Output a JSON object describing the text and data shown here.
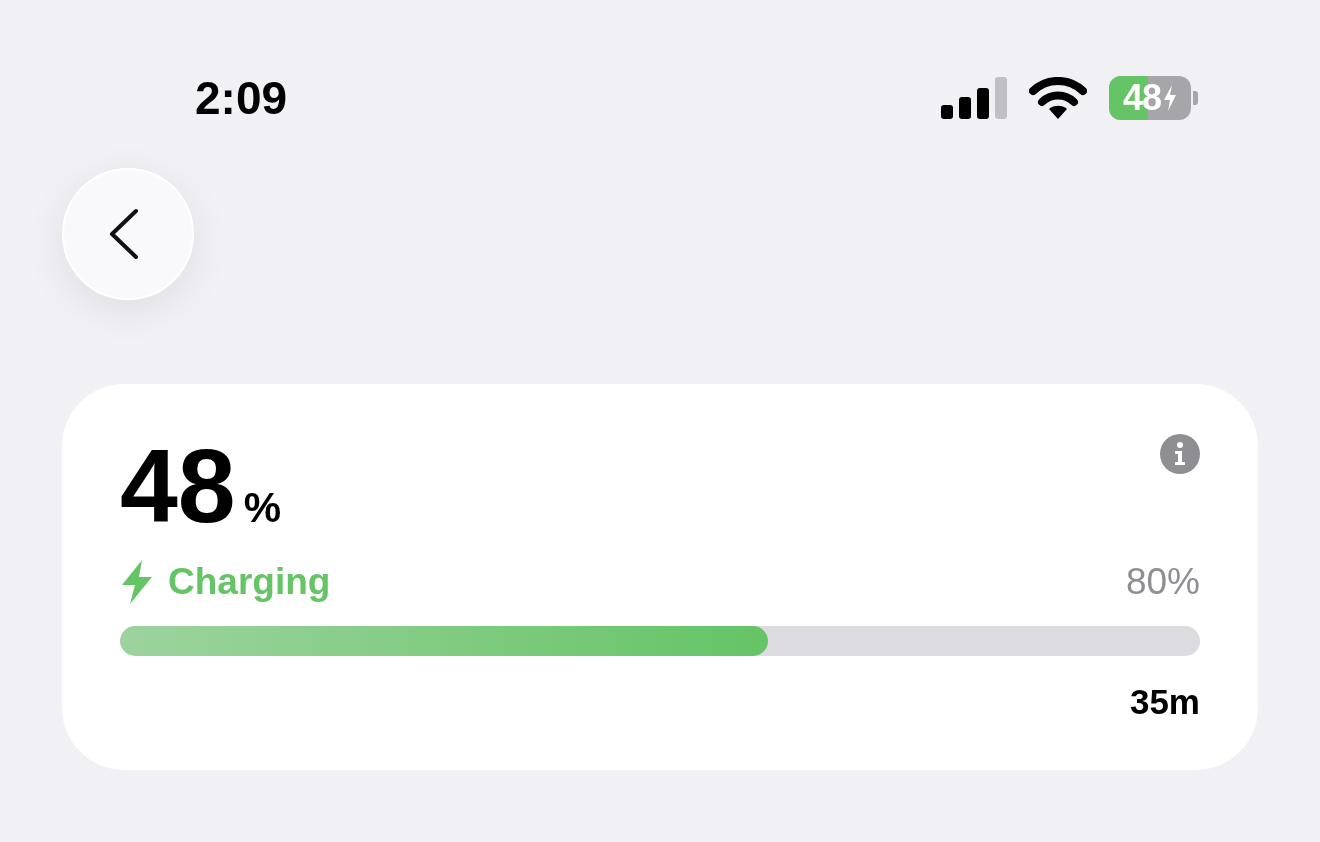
{
  "status_bar": {
    "time": "2:09",
    "battery": "48"
  },
  "card": {
    "percent": "48",
    "unit": "%",
    "status": "Charging",
    "limit": "80%",
    "level": 0.6,
    "remaining": "35m"
  }
}
